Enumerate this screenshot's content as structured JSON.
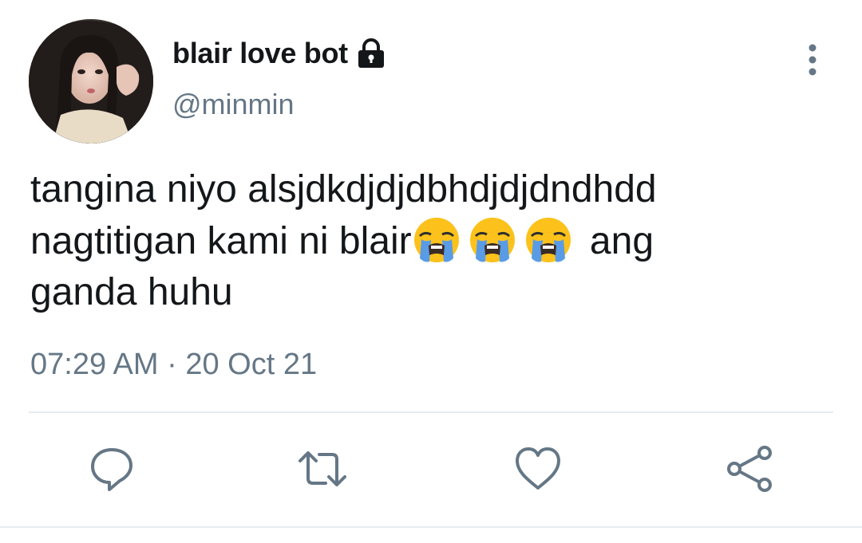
{
  "author": {
    "display_name": "blair love bot",
    "handle": "@minmin",
    "protected": true
  },
  "tweet": {
    "line1": "tangina niyo alsjdkdjdjdbhdjdjdndhdd",
    "line2_prefix": "nagtitigan kami ni blair",
    "line2_suffix": " ang",
    "line3": "ganda huhu",
    "emojis": [
      "loudly-crying-face",
      "loudly-crying-face",
      "loudly-crying-face"
    ],
    "timestamp": "07:29 AM · 20 Oct 21"
  },
  "actions": [
    "reply-icon",
    "retweet-icon",
    "like-icon",
    "share-icon"
  ],
  "colors": {
    "text": "#14171a",
    "secondary": "#657786",
    "divider": "#e6ecf0",
    "icon": "#657786"
  }
}
